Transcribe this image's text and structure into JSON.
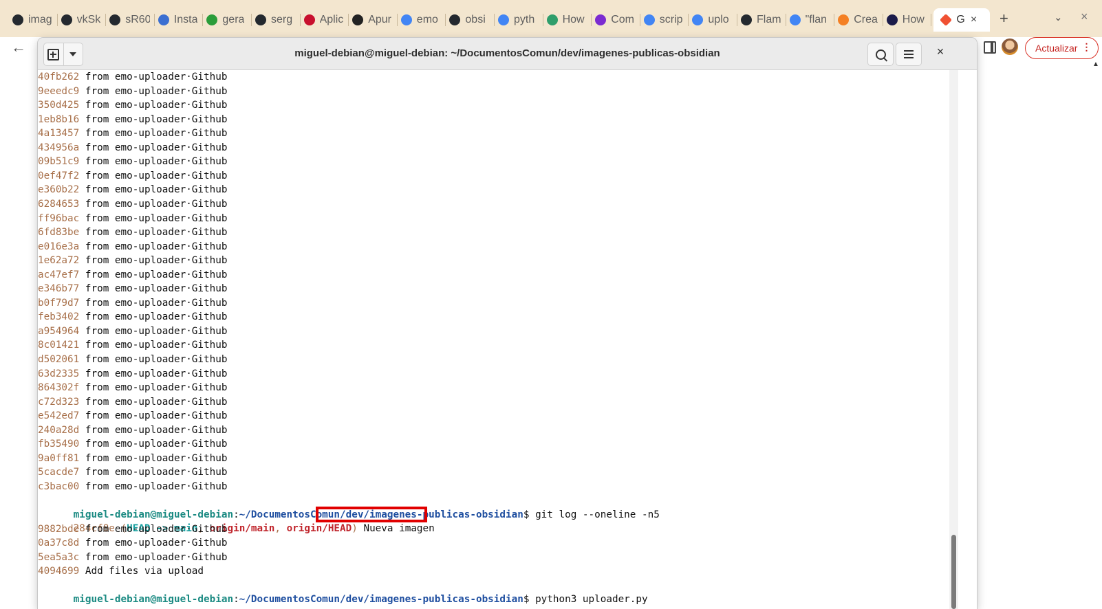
{
  "browser": {
    "tabs": [
      {
        "label": "imag",
        "icon": "github-icon",
        "color": "#24292f"
      },
      {
        "label": "vkSk",
        "icon": "github-icon",
        "color": "#24292f"
      },
      {
        "label": "sR60",
        "icon": "github-icon",
        "color": "#24292f"
      },
      {
        "label": "Insta",
        "icon": "globe-icon",
        "color": "#3b6fd1"
      },
      {
        "label": "gera",
        "icon": "stripes-icon",
        "color": "#2a9d3a"
      },
      {
        "label": "serg",
        "icon": "github-icon",
        "color": "#24292f"
      },
      {
        "label": "Aplic",
        "icon": "hexagon-icon",
        "color": "#c8102e"
      },
      {
        "label": "Apur",
        "icon": "globe-icon",
        "color": "#222222"
      },
      {
        "label": "emo",
        "icon": "google-icon",
        "color": "#4285f4"
      },
      {
        "label": "obsi",
        "icon": "github-icon",
        "color": "#24292f"
      },
      {
        "label": "pyth",
        "icon": "google-icon",
        "color": "#4285f4"
      },
      {
        "label": "How",
        "icon": "bookmark-icon",
        "color": "#2f9e6b"
      },
      {
        "label": "Com",
        "icon": "firefox-icon",
        "color": "#7b2bd1"
      },
      {
        "label": "scrip",
        "icon": "google-icon",
        "color": "#4285f4"
      },
      {
        "label": "uplo",
        "icon": "google-icon",
        "color": "#4285f4"
      },
      {
        "label": "Flam",
        "icon": "github-icon",
        "color": "#24292f"
      },
      {
        "label": "\"flan",
        "icon": "google-icon",
        "color": "#4285f4"
      },
      {
        "label": "Crea",
        "icon": "stackoverflow-icon",
        "color": "#f48024"
      },
      {
        "label": "How",
        "icon": "atlassian-icon",
        "color": "#1b1b4a"
      }
    ],
    "active_tab": {
      "label": "G",
      "icon": "git-icon",
      "color": "#f05133"
    },
    "new_tab_glyph": "+",
    "tab_list_glyph": "⌄",
    "window_close_glyph": "×",
    "back_glyph": "←",
    "update_button": "Actualizar",
    "update_menu_glyph": "⋮",
    "scroll_up_glyph": "▲"
  },
  "terminal": {
    "title": "miguel-debian@miguel-debian: ~/DocumentosComun/dev/imagenes-publicas-obsidian",
    "close_glyph": "×",
    "commit_message": " from emo-uploader·Github",
    "log_lines": [
      "40fb262",
      "9eeedc9",
      "350d425",
      "1eb8b16",
      "4a13457",
      "434956a",
      "09b51c9",
      "0ef47f2",
      "e360b22",
      "6284653",
      "ff96bac",
      "6fd83be",
      "e016e3a",
      "1e62a72",
      "ac47ef7",
      "e346b77",
      "b0f79d7",
      "feb3402",
      "a954964",
      "8c01421",
      "d502061",
      "63d2335",
      "864302f",
      "c72d323",
      "e542ed7",
      "240a28d",
      "fb35490",
      "9a0ff81",
      "5cacde7",
      "c3bac00"
    ],
    "prompt_user": "miguel-debian@miguel-debian",
    "prompt_colon": ":",
    "prompt_path": "~/DocumentosComun/dev/imagenes-publicas-obsidian",
    "prompt_dollar": "$ ",
    "command1": "git log --oneline -n5",
    "head_commit": {
      "hash": "284cf8e",
      "open": " (",
      "head_ref": "HEAD -> main",
      "comma1": ", ",
      "ref1": "origin/main",
      "comma2": ", ",
      "ref2": "origin/HEAD",
      "close": ")",
      "message": " Nueva imagen"
    },
    "recent_lines": [
      {
        "hash": "9882bde",
        "message": " from emo-uploader·Github"
      },
      {
        "hash": "0a37c8d",
        "message": " from emo-uploader·Github"
      },
      {
        "hash": "5ea5a3c",
        "message": " from emo-uploader·Github"
      },
      {
        "hash": "4094699",
        "message": " Add files via upload"
      }
    ],
    "command2": "python3 uploader.py"
  }
}
